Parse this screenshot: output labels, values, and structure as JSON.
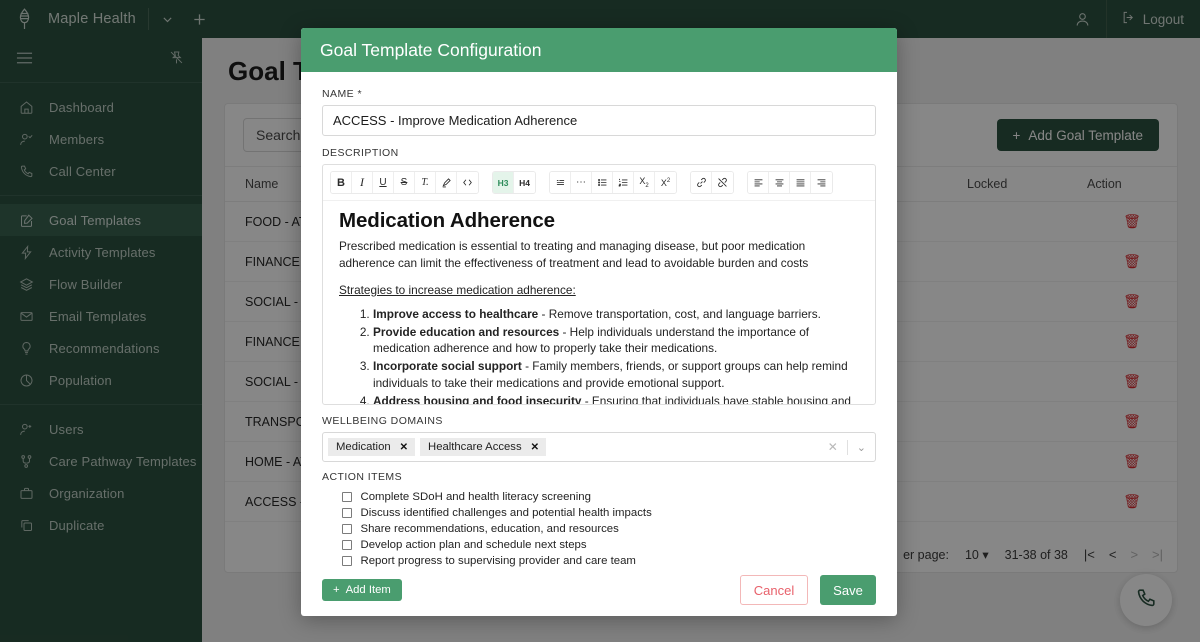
{
  "topbar": {
    "brand": "Maple Health",
    "logo_icon": "maple-leaf-logo",
    "org_chevron_icon": "chevron-down-icon",
    "add_icon": "plus-icon",
    "profile_icon": "person-icon",
    "logout_icon": "logout-icon",
    "logout_label": "Logout"
  },
  "sidebar": {
    "menu_icon": "hamburger-menu-icon",
    "pin_icon": "pin-off-icon",
    "groups": [
      {
        "items": [
          {
            "label": "Dashboard",
            "icon": "home-icon",
            "active": false
          },
          {
            "label": "Members",
            "icon": "person-check-icon",
            "active": false
          },
          {
            "label": "Call Center",
            "icon": "phone-icon",
            "active": false
          }
        ]
      },
      {
        "items": [
          {
            "label": "Goal Templates",
            "icon": "edit-square-icon",
            "active": true
          },
          {
            "label": "Activity Templates",
            "icon": "lightning-icon",
            "active": false
          },
          {
            "label": "Flow Builder",
            "icon": "layers-icon",
            "active": false
          },
          {
            "label": "Email Templates",
            "icon": "envelope-icon",
            "active": false
          },
          {
            "label": "Recommendations",
            "icon": "lightbulb-icon",
            "active": false
          },
          {
            "label": "Population",
            "icon": "pie-chart-icon",
            "active": false
          }
        ]
      },
      {
        "items": [
          {
            "label": "Users",
            "icon": "person-add-icon",
            "active": false
          },
          {
            "label": "Care Pathway Templates",
            "icon": "pathway-icon",
            "active": false
          },
          {
            "label": "Organization",
            "icon": "briefcase-icon",
            "active": false
          },
          {
            "label": "Duplicate",
            "icon": "copy-icon",
            "active": false
          }
        ]
      }
    ]
  },
  "page": {
    "title": "Goal Templates",
    "search_label": "Search",
    "search_icon": "search-icon",
    "add_button": "Add Goal Template",
    "add_button_icon": "plus-icon",
    "columns": [
      "Name",
      "Locked",
      "Action"
    ],
    "rows": [
      {
        "name": "FOOD - ATC...",
        "locked": "",
        "action_icon": "trash-icon"
      },
      {
        "name": "FINANCE - S...",
        "locked": "",
        "action_icon": "trash-icon"
      },
      {
        "name": "SOCIAL - So...",
        "locked": "",
        "action_icon": "trash-icon"
      },
      {
        "name": "FINANCE - S...",
        "locked": "",
        "action_icon": "trash-icon"
      },
      {
        "name": "SOCIAL - So...",
        "locked": "",
        "action_icon": "trash-icon"
      },
      {
        "name": "TRANSPORT...",
        "locked": "",
        "action_icon": "trash-icon"
      },
      {
        "name": "HOME - ATC...",
        "locked": "",
        "action_icon": "trash-icon"
      },
      {
        "name": "ACCESS - Im...",
        "locked": "",
        "action_icon": "trash-icon"
      }
    ],
    "pagination": {
      "per_page_label": "er page:",
      "per_page_value": "10",
      "per_page_caret": "caret-down-icon",
      "range": "31-38 of 38",
      "first_icon": "first-page-icon",
      "prev_icon": "prev-page-icon",
      "next_icon": "next-page-icon",
      "last_icon": "last-page-icon"
    },
    "fab_icon": "phone-icon"
  },
  "modal": {
    "title": "Goal Template Configuration",
    "name_label": "NAME *",
    "name_value": "ACCESS - Improve Medication Adherence",
    "description_label": "DESCRIPTION",
    "toolbar": {
      "groups": [
        [
          {
            "icon": "bold-icon",
            "glyph": "B",
            "active": false
          },
          {
            "icon": "italic-icon",
            "glyph": "I",
            "active": false
          },
          {
            "icon": "underline-icon",
            "glyph": "U",
            "active": false
          },
          {
            "icon": "strikethrough-icon",
            "glyph": "S",
            "active": false
          },
          {
            "icon": "clear-format-icon",
            "glyph": "Ṭ",
            "active": false
          },
          {
            "icon": "highlight-pen-icon",
            "glyph": "",
            "active": false
          },
          {
            "icon": "code-icon",
            "glyph": "</>",
            "active": false
          }
        ],
        [
          {
            "icon": "heading-3-icon",
            "glyph": "H3",
            "active": true
          },
          {
            "icon": "heading-4-icon",
            "glyph": "H4",
            "active": false
          }
        ],
        [
          {
            "icon": "blockquote-icon",
            "glyph": "",
            "active": false
          },
          {
            "icon": "horizontal-rule-icon",
            "glyph": "",
            "active": false
          },
          {
            "icon": "bullet-list-icon",
            "glyph": "",
            "active": false
          },
          {
            "icon": "numbered-list-icon",
            "glyph": "",
            "active": false
          },
          {
            "icon": "subscript-icon",
            "glyph": "X₂",
            "active": false
          },
          {
            "icon": "superscript-icon",
            "glyph": "X²",
            "active": false
          }
        ],
        [
          {
            "icon": "link-icon",
            "glyph": "",
            "active": false
          },
          {
            "icon": "unlink-icon",
            "glyph": "",
            "active": false
          }
        ],
        [
          {
            "icon": "align-left-icon",
            "glyph": "",
            "active": false
          },
          {
            "icon": "align-center-icon",
            "glyph": "",
            "active": false
          },
          {
            "icon": "align-justify-icon",
            "glyph": "",
            "active": false
          },
          {
            "icon": "align-right-icon",
            "glyph": "",
            "active": false
          }
        ]
      ]
    },
    "description": {
      "heading": "Medication Adherence",
      "paragraph": "Prescribed medication is essential to treating and managing disease, but poor medication adherence can limit the effectiveness of treatment and lead to avoidable burden and costs",
      "underlined_line": "Strategies to increase medication adherence:",
      "list": [
        {
          "bold": "Improve access to healthcare",
          "rest": " - Remove transportation, cost, and language barriers."
        },
        {
          "bold": "Provide education and resources",
          "rest": " - Help individuals understand the importance of medication adherence and how to properly take their medications."
        },
        {
          "bold": "Incorporate social support",
          "rest": " - Family members, friends, or support groups can help remind individuals to take their medications and provide emotional support."
        },
        {
          "bold": "Address housing and food insecurity",
          "rest": " - Ensuring that individuals have stable housing and access to healthy food can help them better manage their overall health."
        }
      ]
    },
    "wellbeing_label": "WELLBEING DOMAINS",
    "wellbeing_chips": [
      "Medication",
      "Healthcare Access"
    ],
    "wellbeing_clear_icon": "clear-x-icon",
    "wellbeing_caret_icon": "chevron-down-icon",
    "action_items_label": "ACTION ITEMS",
    "action_items": [
      "Complete SDoH and health literacy screening",
      "Discuss identified challenges and potential health impacts",
      "Share recommendations, education, and resources",
      "Develop action plan and schedule next steps",
      "Report progress to supervising provider and care team"
    ],
    "add_item_label": "Add Item",
    "add_item_icon": "plus-icon",
    "cancel_label": "Cancel",
    "save_label": "Save"
  },
  "colors": {
    "brand_dark_green": "#2d5241",
    "modal_green": "#4a9d6f",
    "cancel_red": "#e8616b",
    "trash_red": "#d9262c",
    "chip_gray": "#ebebeb"
  }
}
